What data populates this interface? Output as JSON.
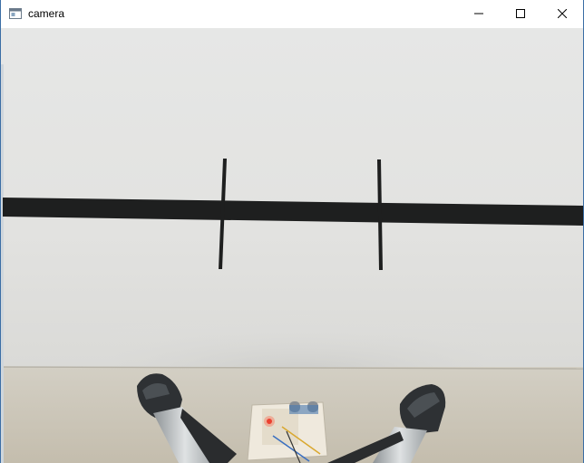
{
  "window": {
    "title": "camera",
    "icons": {
      "app": "window-app-icon",
      "minimize": "minimize-icon",
      "maximize": "maximize-icon",
      "close": "close-icon"
    }
  },
  "colors": {
    "wall": "#e4e4e2",
    "floor": "#c8c2b4",
    "tape": "#1e1f1f",
    "border": "#3b6ea5"
  }
}
